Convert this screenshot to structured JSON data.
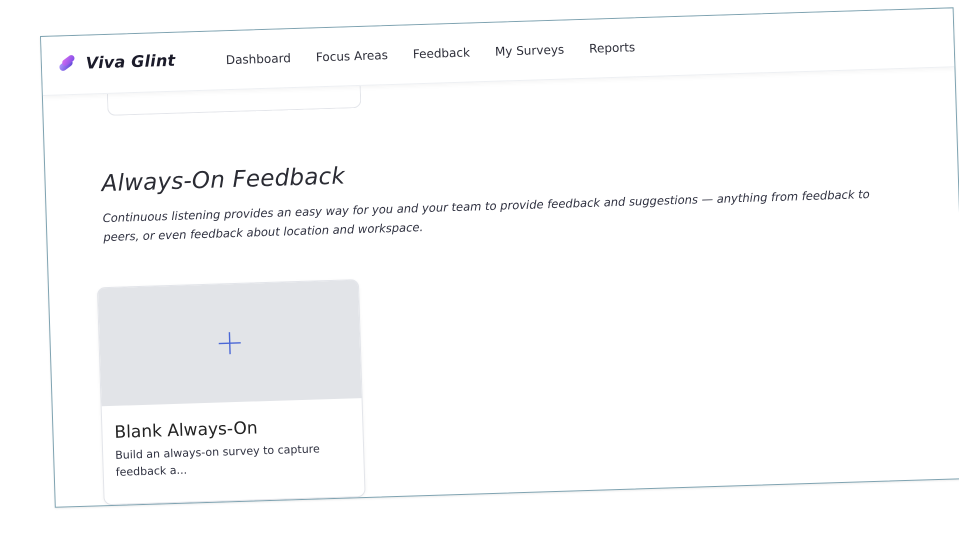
{
  "app": {
    "brand_name": "Viva Glint",
    "logo_icon": "viva-glint-logo-icon",
    "accent_color": "#8b5cf6"
  },
  "nav": {
    "items": [
      "Dashboard",
      "Focus Areas",
      "Feedback",
      "My Surveys",
      "Reports"
    ]
  },
  "section": {
    "title": "Always-On Feedback",
    "description": "Continuous listening provides an easy way for you and your team to provide feedback and suggestions — anything from feedback to peers, or even feedback about location and workspace."
  },
  "card": {
    "icon": "plus-icon",
    "icon_color": "#4a67d6",
    "title": "Blank Always-On",
    "description": "Build an always-on survey to capture feedback a..."
  }
}
